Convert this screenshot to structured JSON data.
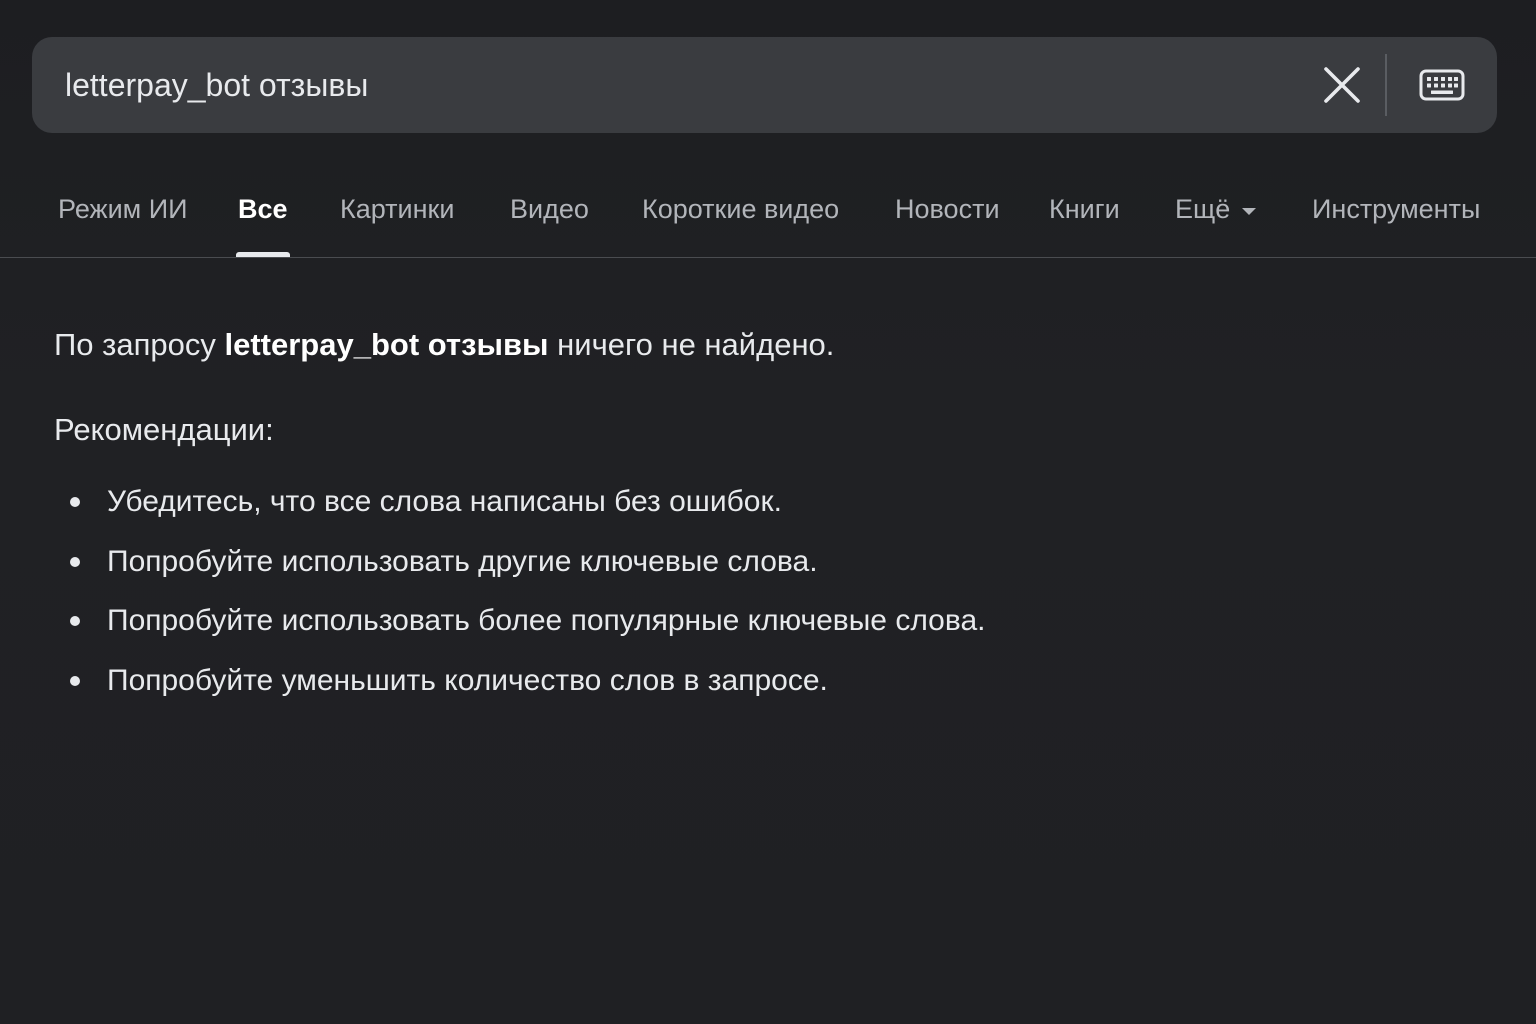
{
  "search": {
    "query": "letterpay_bot отзывы"
  },
  "icons": {
    "clear": "close-icon",
    "keyboard": "keyboard-icon",
    "more": "caret-down-icon"
  },
  "tabs": [
    {
      "label": "Режим ИИ",
      "active": false
    },
    {
      "label": "Все",
      "active": true
    },
    {
      "label": "Картинки",
      "active": false
    },
    {
      "label": "Видео",
      "active": false
    },
    {
      "label": "Короткие видео",
      "active": false
    },
    {
      "label": "Новости",
      "active": false
    },
    {
      "label": "Книги",
      "active": false
    },
    {
      "label": "Ещё",
      "active": false
    },
    {
      "label": "Инструменты",
      "active": false
    }
  ],
  "results": {
    "prefix": "По запросу",
    "query": "letterpay_bot отзывы",
    "suffix": "ничего не найдено.",
    "recommendations_title": "Рекомендации:",
    "recommendations": [
      "Убедитесь, что все слова написаны без ошибок.",
      "Попробуйте использовать другие ключевые слова.",
      "Попробуйте использовать более популярные ключевые слова.",
      "Попробуйте уменьшить количество слов в запросе."
    ]
  },
  "colors": {
    "background": "#202124",
    "search_bar": "#3a3c40",
    "text": "#e8eaed",
    "tab_inactive": "#b2b5ba"
  }
}
